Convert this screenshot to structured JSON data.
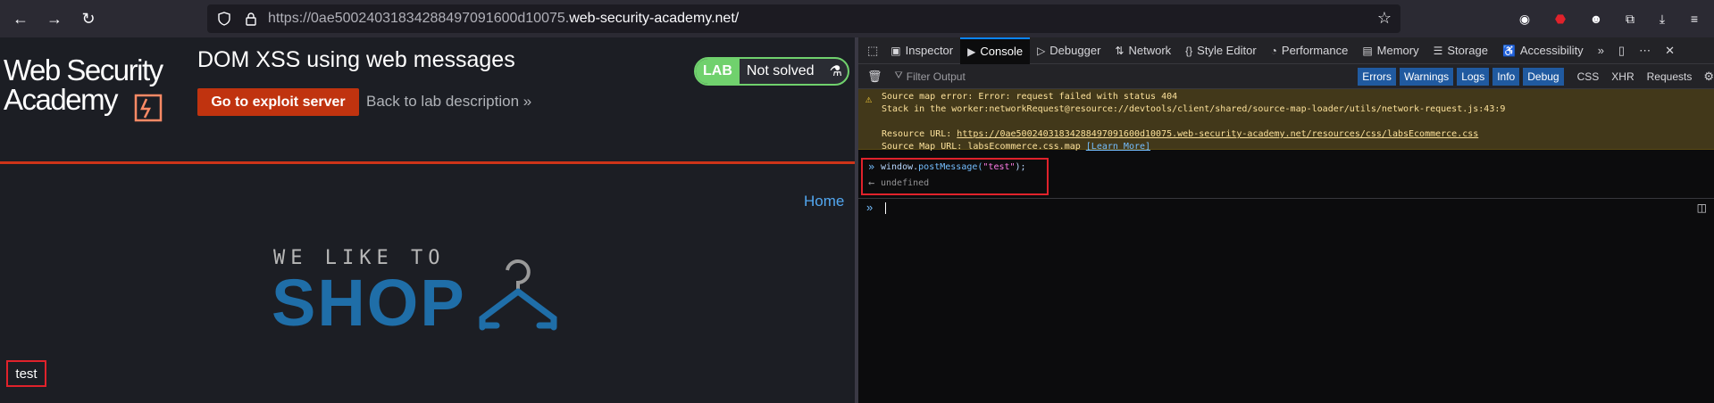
{
  "browser": {
    "url_prefix": "https://0ae5002403183428849709 1600d10075.",
    "url_host_rest": "web-security-academy.net/",
    "url_full_prefix": "https://0ae500240318342884970916 00d10075.",
    "url_display_prefix": "https://0ae50024031834288497091600d10075.",
    "url_display_host": "web-security-academy.net/"
  },
  "header": {
    "logo_line1": "Web Security",
    "logo_line2": "Academy",
    "lab_title": "DOM XSS using web messages",
    "exploit_button": "Go to exploit server",
    "back_link": "Back to lab description",
    "lab_badge": "LAB",
    "lab_status": "Not solved"
  },
  "page": {
    "home_link": "Home",
    "shop_tagline": "WE LIKE TO",
    "shop_word": "SHOP",
    "injected_text": "test"
  },
  "devtools": {
    "tabs": [
      "Inspector",
      "Console",
      "Debugger",
      "Network",
      "Style Editor",
      "Performance",
      "Memory",
      "Storage",
      "Accessibility"
    ],
    "filter_placeholder": "Filter Output",
    "filters": [
      "Errors",
      "Warnings",
      "Logs",
      "Info",
      "Debug"
    ],
    "extra_filters": [
      "CSS",
      "XHR",
      "Requests"
    ],
    "warning": {
      "line1": "Source map error: Error: request failed with status 404",
      "line2": "Stack in the worker:networkRequest@resource://devtools/client/shared/source-map-loader/utils/network-request.js:43:9",
      "resource_label": "Resource URL: ",
      "resource_url": "https://0ae50024031834288497091600d10075.web-security-academy.net/resources/css/labsEcommerce.css",
      "sourcemap_label": "Source Map URL: labsEcommerce.css.map ",
      "learn_more": "[Learn More]"
    },
    "input_prefix": "window.",
    "input_fn": "postMessage(",
    "input_str": "\"test\"",
    "input_suffix": ");",
    "output": "undefined"
  }
}
